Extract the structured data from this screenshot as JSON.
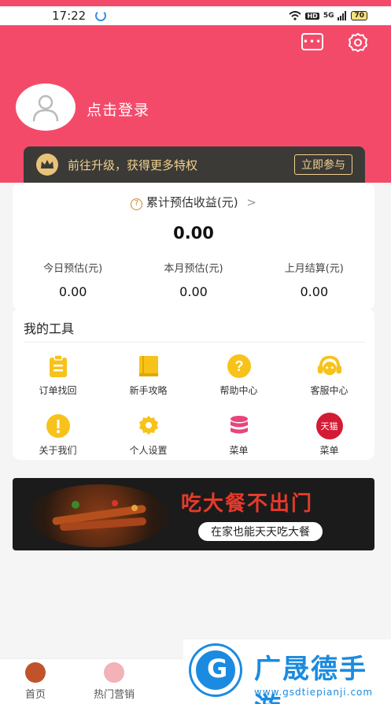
{
  "status_bar": {
    "time": "17:22",
    "network": "HD",
    "signal": "5G",
    "battery": "70"
  },
  "header": {
    "login_text": "点击登录",
    "message_icon": "message-icon",
    "settings_icon": "gear-icon"
  },
  "vip_bar": {
    "text": "前往升级，获得更多特权",
    "button_label": "立即参与"
  },
  "earnings": {
    "title": "累计预估收益(元)",
    "total": "0.00",
    "columns": [
      {
        "label": "今日预估(元)",
        "value": "0.00"
      },
      {
        "label": "本月预估(元)",
        "value": "0.00"
      },
      {
        "label": "上月结算(元)",
        "value": "0.00"
      }
    ]
  },
  "tools": {
    "title": "我的工具",
    "items": [
      {
        "label": "订单找回",
        "icon": "clipboard-icon"
      },
      {
        "label": "新手攻略",
        "icon": "book-icon"
      },
      {
        "label": "帮助中心",
        "icon": "question-icon"
      },
      {
        "label": "客服中心",
        "icon": "headset-icon"
      },
      {
        "label": "关于我们",
        "icon": "info-icon"
      },
      {
        "label": "个人设置",
        "icon": "settings-icon"
      },
      {
        "label": "菜单",
        "icon": "database-icon"
      },
      {
        "label": "菜单",
        "icon": "tmall-icon",
        "badge": "天猫"
      }
    ]
  },
  "banner": {
    "headline": "吃大餐不出门",
    "subtitle": "在家也能天天吃大餐"
  },
  "tabbar": {
    "items": [
      {
        "label": "首页"
      },
      {
        "label": "热门营销"
      }
    ]
  },
  "watermark": {
    "title": "广晟德手游",
    "url": "www.gsdtiepianji.com"
  },
  "colors": {
    "primary": "#f44a6a",
    "gold": "#f1d18f",
    "tool_yellow": "#f7c21a"
  }
}
